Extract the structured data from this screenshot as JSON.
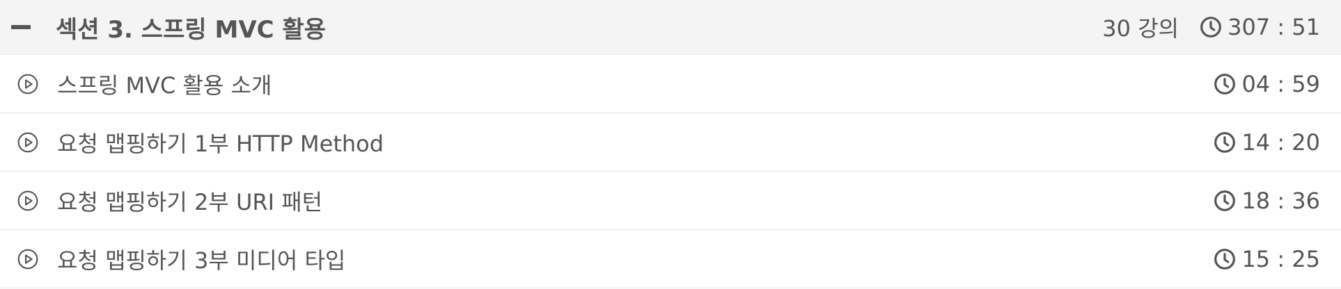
{
  "section": {
    "title": "섹션 3. 스프링 MVC 활용",
    "lecture_count": "30 강의",
    "total_duration": "307 : 51",
    "expanded": true,
    "toggle_icon": "minus-icon"
  },
  "lectures": [
    {
      "title": "스프링 MVC 활용 소개",
      "duration": "04 : 59",
      "icon": "play-circle-icon"
    },
    {
      "title": "요청 맵핑하기 1부 HTTP Method",
      "duration": "14 : 20",
      "icon": "play-circle-icon"
    },
    {
      "title": "요청 맵핑하기 2부 URI 패턴",
      "duration": "18 : 36",
      "icon": "play-circle-icon"
    },
    {
      "title": "요청 맵핑하기 3부 미디어 타입",
      "duration": "15 : 25",
      "icon": "play-circle-icon"
    }
  ],
  "colors": {
    "text": "#555555",
    "header_background": "#f4f4f4",
    "divider": "#e6e6e6"
  }
}
